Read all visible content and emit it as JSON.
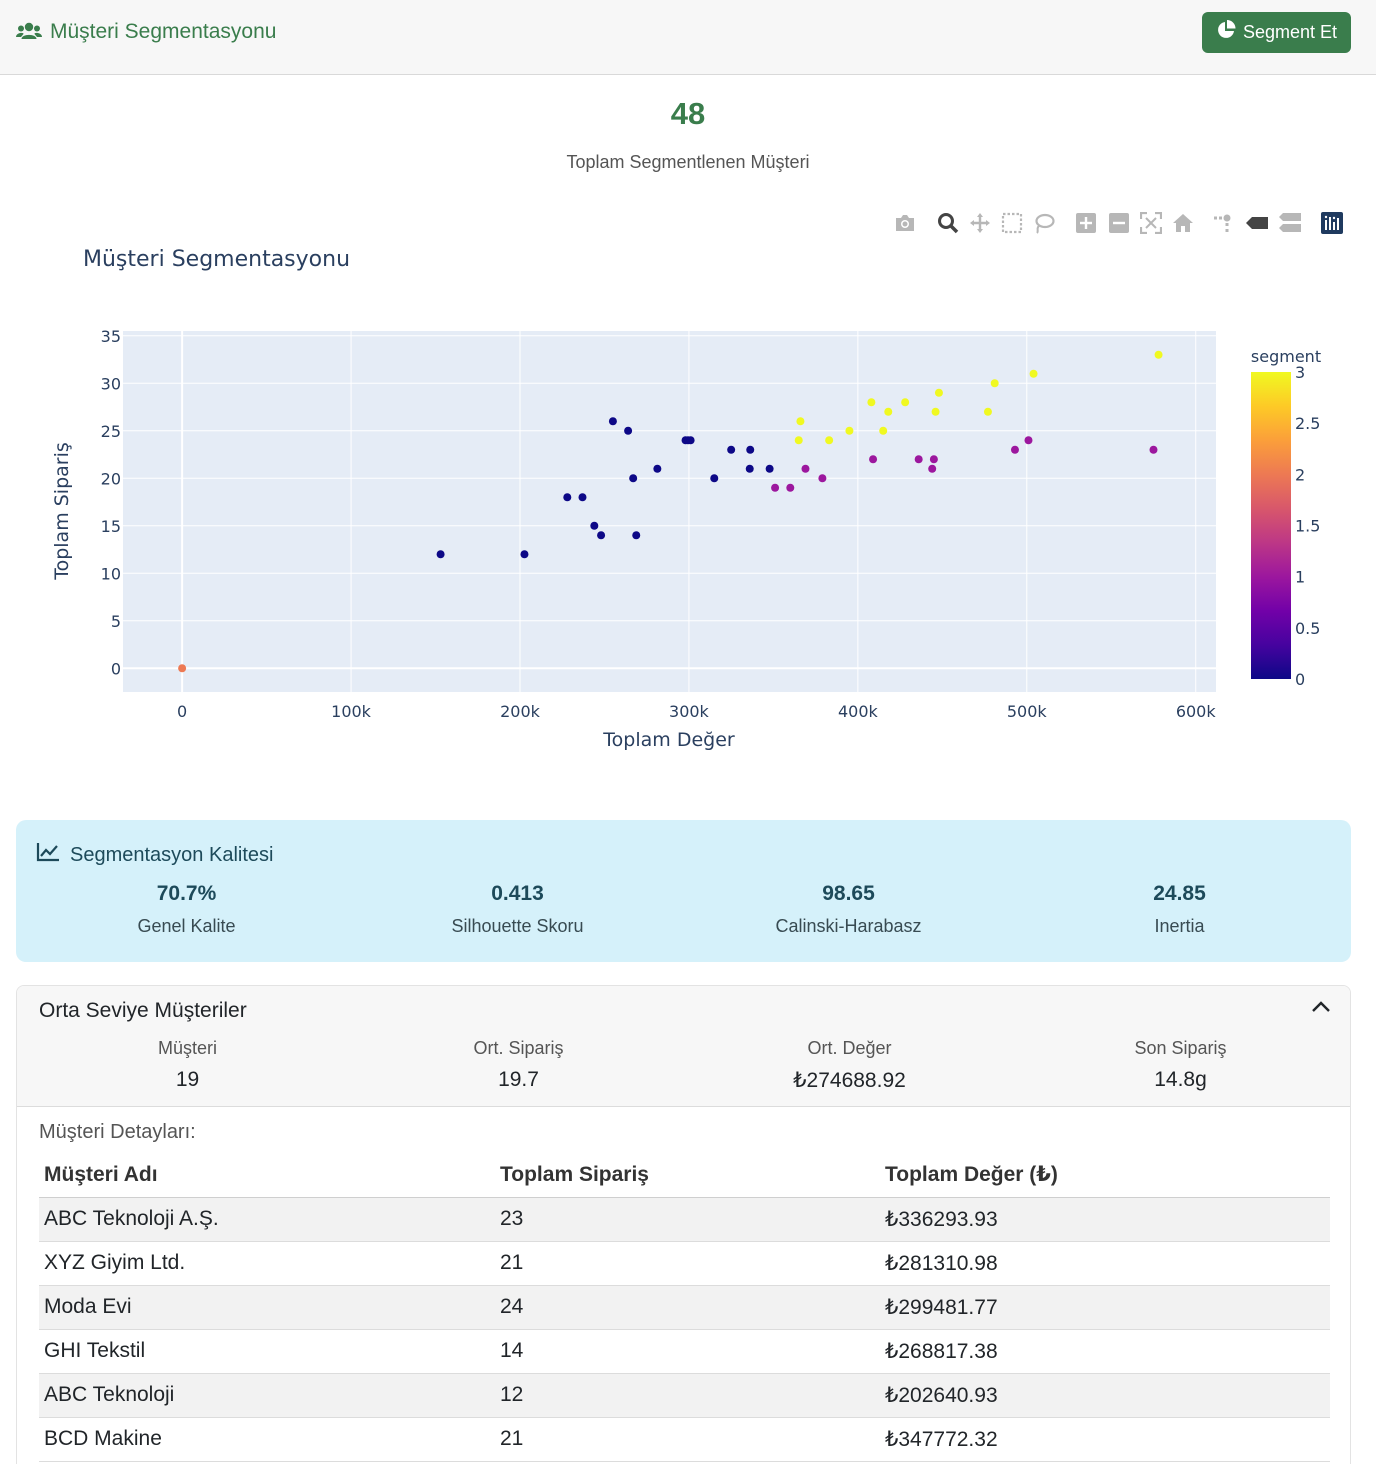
{
  "header": {
    "title": "Müşteri Segmentasyonu",
    "segment_button_label": "Segment Et"
  },
  "summary": {
    "total_count": "48",
    "total_label": "Toplam Segmentlenen Müşteri"
  },
  "modebar": [
    "camera-icon",
    "zoom-icon",
    "pan-icon",
    "box-select-icon",
    "lasso-select-icon",
    "zoom-in-icon",
    "zoom-out-icon",
    "autoscale-icon",
    "reset-axes-icon",
    "spike-lines-icon",
    "hover-closest-icon",
    "hover-compare-icon",
    "plotly-logo-icon"
  ],
  "chart_data": {
    "type": "scatter",
    "title": "Müşteri Segmentasyonu",
    "xlabel": "Toplam Değer",
    "ylabel": "Toplam Sipariş",
    "xlim": [
      -35000,
      612000
    ],
    "ylim": [
      -2.5,
      35.5
    ],
    "x_ticks": [
      0,
      100000,
      200000,
      300000,
      400000,
      500000,
      600000
    ],
    "x_tick_labels": [
      "0",
      "100k",
      "200k",
      "300k",
      "400k",
      "500k",
      "600k"
    ],
    "y_ticks": [
      0,
      5,
      10,
      15,
      20,
      25,
      30,
      35
    ],
    "y_tick_labels": [
      "0",
      "5",
      "10",
      "15",
      "20",
      "25",
      "30",
      "35"
    ],
    "grid": true,
    "colorbar": {
      "title": "segment",
      "min": 0,
      "max": 3,
      "ticks": [
        0,
        0.5,
        1,
        1.5,
        2,
        2.5,
        3
      ],
      "tick_labels": [
        "0",
        "0.5",
        "1",
        "1.5",
        "2",
        "2.5",
        "3"
      ],
      "colorscale": [
        "#0d0887",
        "#46039f",
        "#7201a8",
        "#9c179e",
        "#bd3786",
        "#d8576b",
        "#ed7953",
        "#fb9f3a",
        "#fdca26",
        "#f0f921"
      ]
    },
    "points": [
      {
        "x": 0,
        "y": 0,
        "segment": 2
      },
      {
        "x": 153000,
        "y": 12,
        "segment": 0
      },
      {
        "x": 202640.93,
        "y": 12,
        "segment": 0
      },
      {
        "x": 228000,
        "y": 18,
        "segment": 0
      },
      {
        "x": 237000,
        "y": 18,
        "segment": 0
      },
      {
        "x": 244000,
        "y": 15,
        "segment": 0
      },
      {
        "x": 248000,
        "y": 14,
        "segment": 0
      },
      {
        "x": 255000,
        "y": 26,
        "segment": 0
      },
      {
        "x": 264000,
        "y": 25,
        "segment": 0
      },
      {
        "x": 267000,
        "y": 20,
        "segment": 0
      },
      {
        "x": 268817.38,
        "y": 14,
        "segment": 0
      },
      {
        "x": 281310.98,
        "y": 21,
        "segment": 0
      },
      {
        "x": 298000,
        "y": 24,
        "segment": 0
      },
      {
        "x": 299481.77,
        "y": 24,
        "segment": 0
      },
      {
        "x": 301000,
        "y": 24,
        "segment": 0
      },
      {
        "x": 315000,
        "y": 20,
        "segment": 0
      },
      {
        "x": 325000,
        "y": 23,
        "segment": 0
      },
      {
        "x": 336000,
        "y": 21,
        "segment": 0
      },
      {
        "x": 336293.93,
        "y": 23,
        "segment": 0
      },
      {
        "x": 347772.32,
        "y": 21,
        "segment": 0
      },
      {
        "x": 351000,
        "y": 19,
        "segment": 1
      },
      {
        "x": 360000,
        "y": 19,
        "segment": 1
      },
      {
        "x": 369000,
        "y": 21,
        "segment": 1
      },
      {
        "x": 379000,
        "y": 20,
        "segment": 1
      },
      {
        "x": 409000,
        "y": 22,
        "segment": 1
      },
      {
        "x": 436000,
        "y": 22,
        "segment": 1
      },
      {
        "x": 444000,
        "y": 21,
        "segment": 1
      },
      {
        "x": 445000,
        "y": 22,
        "segment": 1
      },
      {
        "x": 493000,
        "y": 23,
        "segment": 1
      },
      {
        "x": 501000,
        "y": 24,
        "segment": 1
      },
      {
        "x": 575000,
        "y": 23,
        "segment": 1
      },
      {
        "x": 365000,
        "y": 24,
        "segment": 3
      },
      {
        "x": 366000,
        "y": 26,
        "segment": 3
      },
      {
        "x": 383000,
        "y": 24,
        "segment": 3
      },
      {
        "x": 395000,
        "y": 25,
        "segment": 3
      },
      {
        "x": 408000,
        "y": 28,
        "segment": 3
      },
      {
        "x": 415000,
        "y": 25,
        "segment": 3
      },
      {
        "x": 418000,
        "y": 27,
        "segment": 3
      },
      {
        "x": 428000,
        "y": 28,
        "segment": 3
      },
      {
        "x": 446000,
        "y": 27,
        "segment": 3
      },
      {
        "x": 448000,
        "y": 29,
        "segment": 3
      },
      {
        "x": 477000,
        "y": 27,
        "segment": 3
      },
      {
        "x": 481000,
        "y": 30,
        "segment": 3
      },
      {
        "x": 504000,
        "y": 31,
        "segment": 3
      },
      {
        "x": 578000,
        "y": 33,
        "segment": 3
      }
    ]
  },
  "quality": {
    "title": "Segmentasyon Kalitesi",
    "metrics": [
      {
        "value": "70.7%",
        "label": "Genel Kalite"
      },
      {
        "value": "0.413",
        "label": "Silhouette Skoru"
      },
      {
        "value": "98.65",
        "label": "Calinski-Harabasz"
      },
      {
        "value": "24.85",
        "label": "Inertia"
      }
    ]
  },
  "segment_card": {
    "title": "Orta Seviye Müşteriler",
    "stats": [
      {
        "label": "Müşteri",
        "value": "19"
      },
      {
        "label": "Ort. Sipariş",
        "value": "19.7"
      },
      {
        "label": "Ort. Değer",
        "value": "₺274688.92"
      },
      {
        "label": "Son Sipariş",
        "value": "14.8g"
      }
    ],
    "details_label": "Müşteri Detayları:",
    "table": {
      "headers": [
        "Müşteri Adı",
        "Toplam Sipariş",
        "Toplam Değer (₺)"
      ],
      "rows": [
        [
          "ABC Teknoloji A.Ş.",
          "23",
          "₺336293.93"
        ],
        [
          "XYZ Giyim Ltd.",
          "21",
          "₺281310.98"
        ],
        [
          "Moda Evi",
          "24",
          "₺299481.77"
        ],
        [
          "GHI Tekstil",
          "14",
          "₺268817.38"
        ],
        [
          "ABC Teknoloji",
          "12",
          "₺202640.93"
        ],
        [
          "BCD Makine",
          "21",
          "₺347772.32"
        ]
      ]
    }
  }
}
